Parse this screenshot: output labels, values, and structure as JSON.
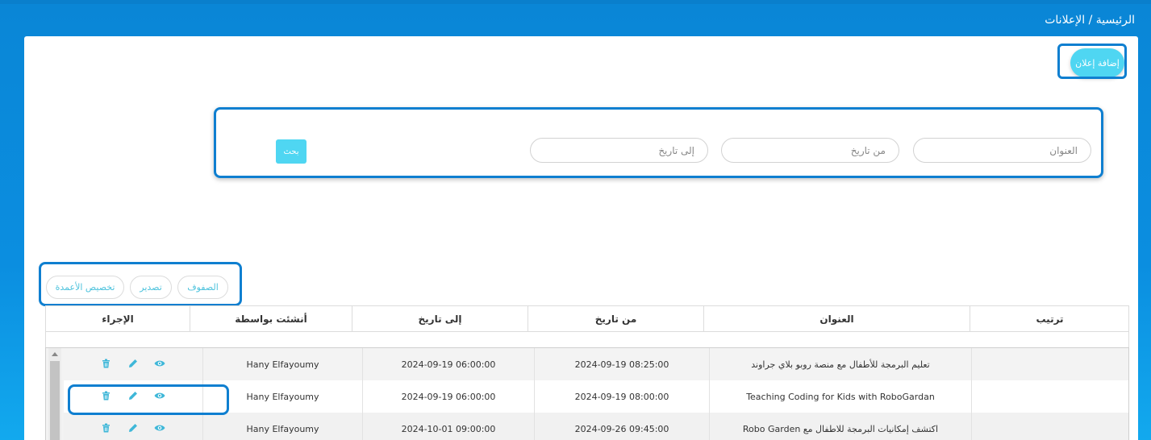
{
  "breadcrumb": "الرئيسية / الإعلانات",
  "add_button": "إضافة إعلان",
  "search": {
    "title_placeholder": "العنوان",
    "from_date_placeholder": "من تاريخ",
    "to_date_placeholder": "إلى تاريخ",
    "search_button": "بحث"
  },
  "toolbar": {
    "rows": "الصفوف",
    "export": "تصدير",
    "customize_columns": "تخصيص الأعمدة"
  },
  "table": {
    "headers": {
      "order": "ترتيب",
      "title": "العنوان",
      "from_date": "من تاريخ",
      "to_date": "إلى تاريخ",
      "created_by": "أنشئت بواسطة",
      "action": "الإجراء"
    },
    "rows": [
      {
        "order": "",
        "title": "تعليم البرمجة للأطفال مع منصة روبو بلاي جراوند",
        "from_date": "2024-09-19 08:25:00",
        "to_date": "2024-09-19 06:00:00",
        "created_by": "Hany Elfayoumy"
      },
      {
        "order": "",
        "title": "Teaching Coding for Kids with RoboGardan",
        "from_date": "2024-09-19 08:00:00",
        "to_date": "2024-09-19 06:00:00",
        "created_by": "Hany Elfayoumy"
      },
      {
        "order": "",
        "title": "اكتشف إمكانيات البرمجة للاطفال مع Robo Garden",
        "from_date": "2024-09-26 09:45:00",
        "to_date": "2024-10-01 09:00:00",
        "created_by": "Hany Elfayoumy"
      }
    ]
  },
  "colors": {
    "header_blue": "#0b8ee0",
    "accent_cyan": "#4fd6f2",
    "highlight_border": "#0f7fd0",
    "icon_color": "#3fb7d8"
  },
  "icons": {
    "delete": "trash-icon",
    "edit": "pencil-icon",
    "view": "eye-icon"
  }
}
